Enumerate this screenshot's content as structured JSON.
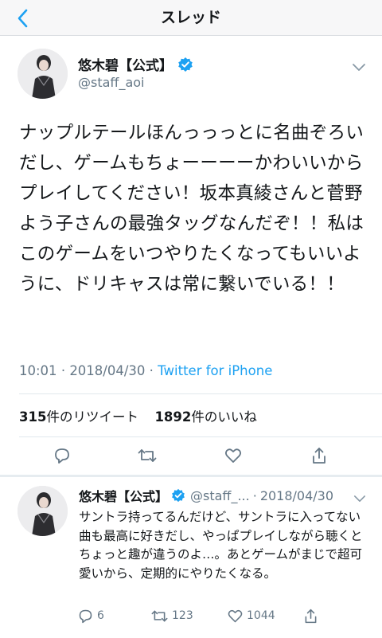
{
  "nav": {
    "title": "スレッド"
  },
  "tweet": {
    "author_name": "悠木碧【公式】",
    "handle": "@staff_aoi",
    "text": "ナップルテールほんっっっとに名曲ぞろいだし、ゲームもちょーーーーかわいいからプレイしてください！坂本真綾さんと菅野よう子さんの最強タッグなんだぞ！！私はこのゲームをいつやりたくなってもいいように、ドリキャスは常に繋いでいる！！",
    "time": "10:01",
    "date": "2018/04/30",
    "separator": "·",
    "source": "Twitter for iPhone",
    "retweet_count": "315",
    "retweet_label": "件のリツイート",
    "like_count": "1892",
    "like_label": "件のいいね"
  },
  "reply": {
    "author_name": "悠木碧【公式】",
    "handle": "@staff_...",
    "separator": "·",
    "date": "2018/04/30",
    "text": "サントラ持ってるんだけど、サントラに入ってない曲も最高に好きだし、やっぱプレイしながら聴くとちょっと趣が違うのよ…。あとゲームがまじで超可愛いから、定期的にやりたくなる。",
    "reply_count": "6",
    "retweet_count": "123",
    "like_count": "1044"
  },
  "colors": {
    "accent": "#1da1f2",
    "text": "#14171a",
    "secondary": "#657786",
    "verified": "#1da1f2"
  },
  "icons": {
    "back": "chevron-left-icon",
    "verified": "verified-badge-icon",
    "caret": "chevron-down-icon",
    "reply": "reply-icon",
    "retweet": "retweet-icon",
    "like": "heart-icon",
    "share": "share-icon"
  }
}
